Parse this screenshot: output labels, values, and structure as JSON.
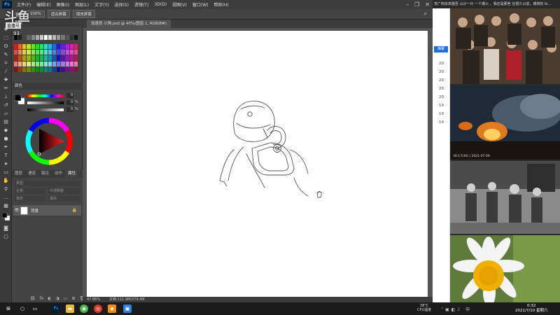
{
  "app": {
    "menus": [
      "文件(F)",
      "编辑(E)",
      "图像(I)",
      "图层(L)",
      "文字(Y)",
      "选择(S)",
      "滤镜(T)",
      "3D(D)",
      "视图(V)",
      "窗口(W)",
      "帮助(H)"
    ],
    "options_bar": {
      "lock_text": "窗口",
      "zoom_value": "100%",
      "fit_screen": "适合屏幕",
      "fill_screen": "填充屏幕"
    },
    "doc_tab": "加速员 小狗.psd @ 40%(图层 1, RGB/8#)",
    "status": {
      "zoom": "47.86%",
      "doc_info": "文档:111.9M/279.4M"
    }
  },
  "watermark": {
    "logo": "斗鱼",
    "sub": "直播号",
    "number": "93"
  },
  "panels": {
    "swatches_label": "色板",
    "color_label": "颜色",
    "sliders": [
      {
        "value": "0"
      },
      {
        "value": "0"
      },
      {
        "value": "0"
      }
    ],
    "pct": "%",
    "layer_tabs": [
      "图层",
      "通道",
      "路径",
      "动作",
      "属性"
    ],
    "layer_filter": "类型",
    "layer_blend": "正常",
    "layer_opacity": "不透明度",
    "layer_fill": "填充",
    "layer_lock": "锁定",
    "layer_name": "背景"
  },
  "browser": {
    "title": "李广刺杀高骚吾 山沙一片 一个爆火 ，我还是那些 在很久以前，爆燃的 bi...",
    "tag": "弹幕",
    "list_numbers": [
      "20",
      "20",
      "20",
      "20",
      "20",
      "19",
      "19",
      "19",
      "19"
    ],
    "captions": [
      "",
      "30:17(40) | 2021-07-09",
      "",
      ""
    ]
  },
  "taskbar": {
    "temp": "38°C",
    "temp_label": "CPU温度",
    "time": "0:32",
    "date": "2021/7/10 星期六"
  },
  "colors": {
    "ps_bg": "#535353",
    "panel_bg": "#434343",
    "accent": "#31a8ff",
    "taskbar": "#1c1c1c"
  }
}
